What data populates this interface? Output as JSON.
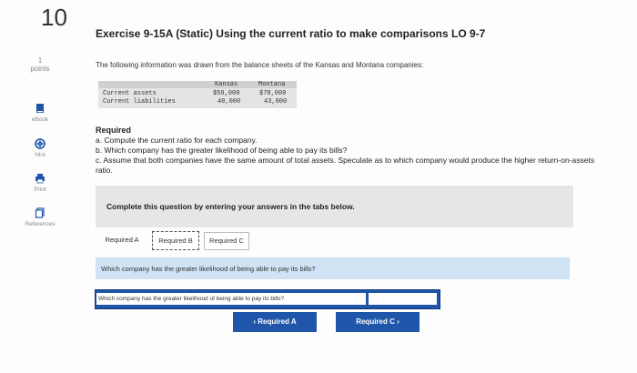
{
  "question_number": "10",
  "points": {
    "value": "1",
    "label": "points"
  },
  "sidebar": {
    "ebook": "eBook",
    "hint": "Hint",
    "print": "Print",
    "references": "References"
  },
  "title": "Exercise 9-15A (Static) Using the current ratio to make comparisons LO 9-7",
  "intro": "The following information was drawn from the balance sheets of the Kansas and Montana companies:",
  "table": {
    "headers": [
      "Kansas",
      "Montana"
    ],
    "rows": [
      {
        "label": "Current assets",
        "kansas": "$59,000",
        "montana": "$78,000"
      },
      {
        "label": "Current liabilities",
        "kansas": "40,000",
        "montana": "43,000"
      }
    ]
  },
  "required": {
    "heading": "Required",
    "a": "a. Compute the current ratio for each company.",
    "b": "b. Which company has the greater likelihood of being able to pay its bills?",
    "c": "c. Assume that both companies have the same amount of total assets. Speculate as to which company would produce the higher return-on-assets ratio."
  },
  "instruction": "Complete this question by entering your answers in the tabs below.",
  "tabs": [
    "Required A",
    "Required B",
    "Required C"
  ],
  "question": "Which company has the greater likelihood of being able to pay its bills?",
  "answer_label": "Which company has the greater likelihood of being able to pay its bills?",
  "answer_value": "",
  "nav": {
    "prev": "Required A",
    "next": "Required C"
  },
  "colors": {
    "accent": "#1f56a9",
    "question_bar": "#cfe3f4"
  }
}
